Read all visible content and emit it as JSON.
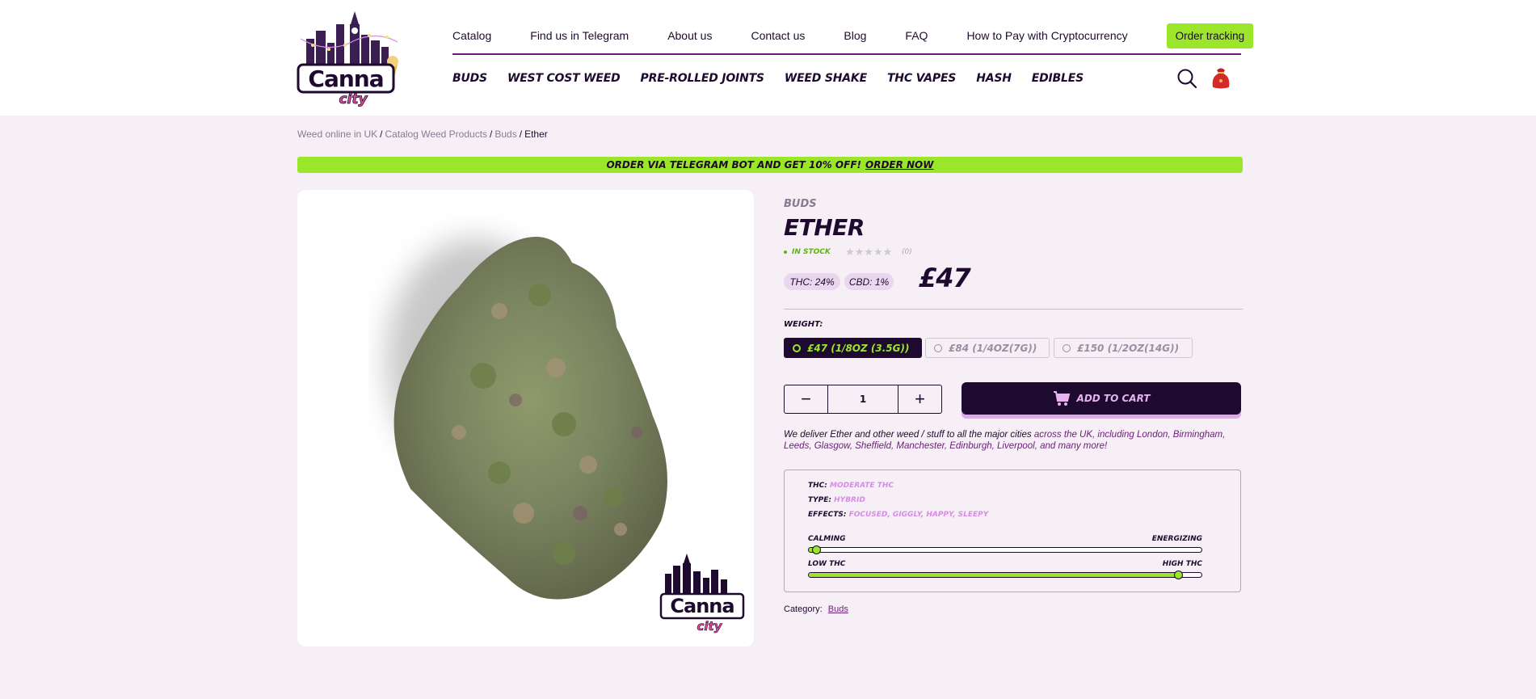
{
  "brand": {
    "logo_text": "Canna",
    "logo_sub": "city"
  },
  "topnav": {
    "items": [
      "Catalog",
      "Find us in Telegram",
      "About us",
      "Contact us",
      "Blog",
      "FAQ",
      "How to Pay with Cryptocurrency"
    ],
    "order_tracking": "Order tracking"
  },
  "catnav": [
    "BUDS",
    "WEST COST WEED",
    "PRE-ROLLED JOINTS",
    "WEED SHAKE",
    "THC VAPES",
    "HASH",
    "EDIBLES"
  ],
  "icons": {
    "search": "search-icon",
    "cart": "cart-bag-icon"
  },
  "breadcrumb": {
    "items": [
      "Weed online in UK",
      "Catalog Weed Products",
      "Buds"
    ],
    "current": "Ether",
    "separator": "/"
  },
  "promo": {
    "text": "ORDER VIA TELEGRAM BOT AND GET 10% OFF!",
    "link": "ORDER NOW"
  },
  "product": {
    "category": "BUDS",
    "title": "ETHER",
    "stock": "IN STOCK",
    "rating": {
      "stars": "★★★★★",
      "count": "(0)",
      "value": 0
    },
    "thc": "THC: 24%",
    "cbd": "CBD: 1%",
    "price": "£47",
    "weight_label": "WEIGHT:",
    "weights": [
      {
        "label": "£47 (1/8OZ (3.5G))",
        "selected": true
      },
      {
        "label": "£84 (1/4OZ(7G))",
        "selected": false
      },
      {
        "label": "£150 (1/2OZ(14G))",
        "selected": false
      }
    ],
    "quantity": "1",
    "qty_minus": "−",
    "qty_plus": "+",
    "add_to_cart": "ADD TO CART",
    "deliver_text": "We deliver Ether and other weed / stuff to all the major cities",
    "deliver_highlight": "across the UK, including London, Birmingham, Leeds, Glasgow, Sheffield, Manchester, Edinburgh, Liverpool, and many more!",
    "specs": {
      "thc_label": "THC:",
      "thc_value": "MODERATE THC",
      "type_label": "TYPE:",
      "type_value": "HYBRID",
      "effects_label": "EFFECTS:",
      "effects_value": "FOCUSED, GIGGLY, HAPPY, SLEEPY",
      "slider1": {
        "left": "CALMING",
        "right": "ENERGIZING",
        "value": 0.01
      },
      "slider2": {
        "left": "LOW THC",
        "right": "HIGH THC",
        "value": 0.95
      }
    },
    "category_label": "Category:",
    "category_link": "Buds"
  },
  "colors": {
    "accent_green": "#9be62a",
    "dark_purple": "#1e0a2e",
    "purple": "#6b1b7a",
    "pink": "#d88be6",
    "bg": "#f6eff5"
  }
}
